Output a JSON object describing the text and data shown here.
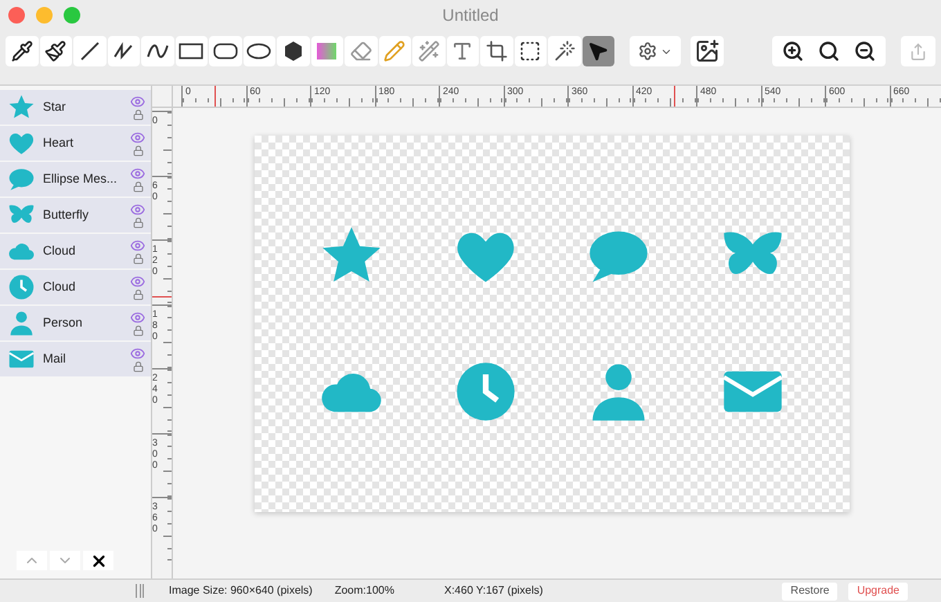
{
  "window": {
    "title": "Untitled"
  },
  "toolbar": {
    "tools": [
      {
        "kind": "eyedropper",
        "selected": false
      },
      {
        "kind": "brush",
        "selected": false
      },
      {
        "kind": "line",
        "selected": false
      },
      {
        "kind": "zigzag",
        "selected": false
      },
      {
        "kind": "curve",
        "selected": false
      },
      {
        "kind": "rectangle",
        "selected": false
      },
      {
        "kind": "rounded-rectangle",
        "selected": false
      },
      {
        "kind": "ellipse",
        "selected": false
      },
      {
        "kind": "hexagon",
        "selected": false
      },
      {
        "kind": "gradient",
        "selected": false
      },
      {
        "kind": "eraser",
        "selected": false
      },
      {
        "kind": "pencil",
        "selected": false
      },
      {
        "kind": "wand",
        "selected": false
      },
      {
        "kind": "text",
        "selected": false
      },
      {
        "kind": "crop",
        "selected": false
      },
      {
        "kind": "marquee",
        "selected": false
      },
      {
        "kind": "lasso",
        "selected": false
      },
      {
        "kind": "pointer",
        "selected": true
      }
    ],
    "zoom": [
      {
        "kind": "in"
      },
      {
        "kind": "actual"
      },
      {
        "kind": "out"
      }
    ]
  },
  "layers": [
    {
      "name": "Star",
      "kind": "star",
      "visible": true
    },
    {
      "name": "Heart",
      "kind": "heart",
      "visible": true
    },
    {
      "name": "Ellipse Mes...",
      "kind": "bubble",
      "visible": true
    },
    {
      "name": "Butterfly",
      "kind": "butterfly",
      "visible": true
    },
    {
      "name": "Cloud",
      "kind": "cloud",
      "visible": true
    },
    {
      "name": "Cloud",
      "kind": "clock",
      "visible": true
    },
    {
      "name": "Person",
      "kind": "person",
      "visible": true
    },
    {
      "name": "Mail",
      "kind": "mail",
      "visible": true
    }
  ],
  "ruler": {
    "horizontal": [
      "0",
      "60",
      "120",
      "180",
      "240",
      "300",
      "360",
      "420",
      "480",
      "540",
      "600",
      "660"
    ],
    "vertical": [
      "0",
      "60",
      "120",
      "180",
      "240",
      "300",
      "360"
    ]
  },
  "status_bar": {
    "image_size": "Image Size: 960×640 (pixels)",
    "zoom": "Zoom:100%",
    "position": "X:460 Y:167 (pixels)",
    "buttons": [
      "Restore",
      "Upgrade"
    ]
  }
}
